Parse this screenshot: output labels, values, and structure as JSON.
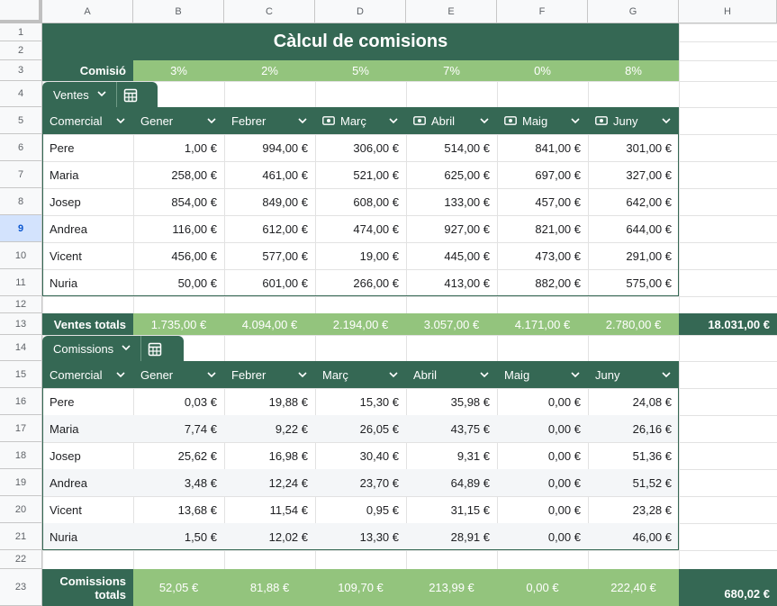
{
  "columns": [
    "A",
    "B",
    "C",
    "D",
    "E",
    "F",
    "G",
    "H"
  ],
  "rows": [
    "1",
    "2",
    "3",
    "4",
    "5",
    "6",
    "7",
    "8",
    "9",
    "10",
    "11",
    "12",
    "13",
    "14",
    "15",
    "16",
    "17",
    "18",
    "19",
    "20",
    "21",
    "22",
    "23"
  ],
  "selected_row": "9",
  "title": "Càlcul de comisions",
  "commission": {
    "label": "Comisió",
    "rates": [
      "3%",
      "2%",
      "5%",
      "7%",
      "0%",
      "8%"
    ]
  },
  "sales_table": {
    "name": "Ventes",
    "headers": [
      "Comercial",
      "Gener",
      "Febrer",
      "Març",
      "Abril",
      "Maig",
      "Juny"
    ],
    "money_icon_cols": [
      3,
      4,
      5,
      6
    ],
    "rows": [
      [
        "Pere",
        "1,00 €",
        "994,00 €",
        "306,00 €",
        "514,00 €",
        "841,00 €",
        "301,00 €"
      ],
      [
        "Maria",
        "258,00 €",
        "461,00 €",
        "521,00 €",
        "625,00 €",
        "697,00 €",
        "327,00 €"
      ],
      [
        "Josep",
        "854,00 €",
        "849,00 €",
        "608,00 €",
        "133,00 €",
        "457,00 €",
        "642,00 €"
      ],
      [
        "Andrea",
        "116,00 €",
        "612,00 €",
        "474,00 €",
        "927,00 €",
        "821,00 €",
        "644,00 €"
      ],
      [
        "Vicent",
        "456,00 €",
        "577,00 €",
        "19,00 €",
        "445,00 €",
        "473,00 €",
        "291,00 €"
      ],
      [
        "Nuria",
        "50,00 €",
        "601,00 €",
        "266,00 €",
        "413,00 €",
        "882,00 €",
        "575,00 €"
      ]
    ]
  },
  "sales_totals": {
    "label": "Ventes totals",
    "values": [
      "1.735,00 €",
      "4.094,00 €",
      "2.194,00 €",
      "3.057,00 €",
      "4.171,00 €",
      "2.780,00 €"
    ],
    "grand_total": "18.031,00 €"
  },
  "commissions_table": {
    "name": "Comissions",
    "headers": [
      "Comercial",
      "Gener",
      "Febrer",
      "Març",
      "Abril",
      "Maig",
      "Juny"
    ],
    "rows": [
      [
        "Pere",
        "0,03 €",
        "19,88 €",
        "15,30 €",
        "35,98 €",
        "0,00 €",
        "24,08 €"
      ],
      [
        "Maria",
        "7,74 €",
        "9,22 €",
        "26,05 €",
        "43,75 €",
        "0,00 €",
        "26,16 €"
      ],
      [
        "Josep",
        "25,62 €",
        "16,98 €",
        "30,40 €",
        "9,31 €",
        "0,00 €",
        "51,36 €"
      ],
      [
        "Andrea",
        "3,48 €",
        "12,24 €",
        "23,70 €",
        "64,89 €",
        "0,00 €",
        "51,52 €"
      ],
      [
        "Vicent",
        "13,68 €",
        "11,54 €",
        "0,95 €",
        "31,15 €",
        "0,00 €",
        "23,28 €"
      ],
      [
        "Nuria",
        "1,50 €",
        "12,02 €",
        "13,30 €",
        "28,91 €",
        "0,00 €",
        "46,00 €"
      ]
    ]
  },
  "commission_totals": {
    "label_line1": "Comissions",
    "label_line2": "totals",
    "values": [
      "52,05 €",
      "81,88 €",
      "109,70 €",
      "213,99 €",
      "0,00 €",
      "222,40 €"
    ],
    "grand_total": "680,02 €"
  },
  "colors": {
    "dark_green": "#356854",
    "light_green": "#93c47d",
    "selected_row_header": "#d3e3fd"
  }
}
